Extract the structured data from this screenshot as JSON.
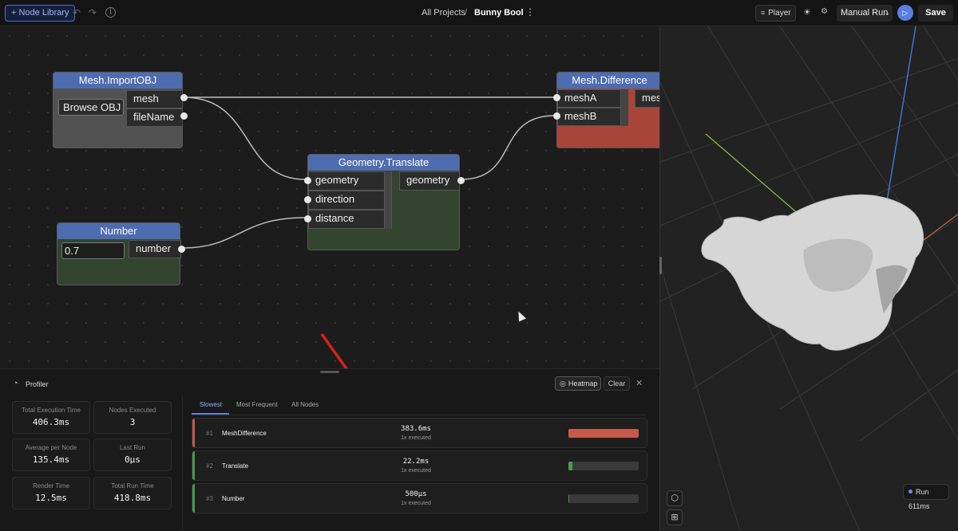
{
  "topbar": {
    "node_library_label": "+ Node Library",
    "breadcrumb_root": "All Projects",
    "breadcrumb_sep": "/",
    "project_name": "Bunny Bool",
    "player_label": "Player",
    "run_mode_label": "Manual Run",
    "save_label": "Save"
  },
  "nodes": {
    "import": {
      "title": "Mesh.ImportOBJ",
      "button": "Browse OBJ",
      "outputs": [
        "mesh",
        "fileName"
      ]
    },
    "translate": {
      "title": "Geometry.Translate",
      "inputs": [
        "geometry",
        "direction",
        "distance"
      ],
      "outputs": [
        "geometry"
      ]
    },
    "difference": {
      "title": "Mesh.Difference",
      "inputs": [
        "meshA",
        "meshB"
      ],
      "output_partial": "mes"
    },
    "number": {
      "title": "Number",
      "value": "0.7",
      "outputs": [
        "number"
      ]
    }
  },
  "colors": {
    "node_header": "#4e6cb0",
    "difference_body": "#a9443a",
    "translate_body": "#33452f",
    "number_body": "#33452f",
    "import_body": "#525252",
    "accent": "#5b7fe0",
    "bar_slow": "#c65a4a",
    "bar_ok": "#4a9a50"
  },
  "viewport": {
    "run_badge": "Run 611ms"
  },
  "profiler": {
    "title": "Profiler",
    "heatmap_label": "Heatmap",
    "clear_label": "Clear",
    "stats": [
      {
        "label": "Total Execution Time",
        "value": "406.3ms"
      },
      {
        "label": "Nodes Executed",
        "value": "3"
      },
      {
        "label": "Average per Node",
        "value": "135.4ms"
      },
      {
        "label": "Last Run",
        "value": "0µs"
      },
      {
        "label": "Render Time",
        "value": "12.5ms"
      },
      {
        "label": "Total Run Time",
        "value": "418.8ms"
      }
    ],
    "tabs": [
      "Slowest",
      "Most Frequent",
      "All Nodes"
    ],
    "rows": [
      {
        "rank": "#1",
        "name": "MeshDifference",
        "time": "383.6ms",
        "executed": "1x executed",
        "fraction": 1.0,
        "accent": "#c65a4a"
      },
      {
        "rank": "#2",
        "name": "Translate",
        "time": "22.2ms",
        "executed": "1x executed",
        "fraction": 0.058,
        "accent": "#4a9a50"
      },
      {
        "rank": "#3",
        "name": "Number",
        "time": "500µs",
        "executed": "1x executed",
        "fraction": 0.0013,
        "accent": "#4a9a50"
      }
    ]
  }
}
